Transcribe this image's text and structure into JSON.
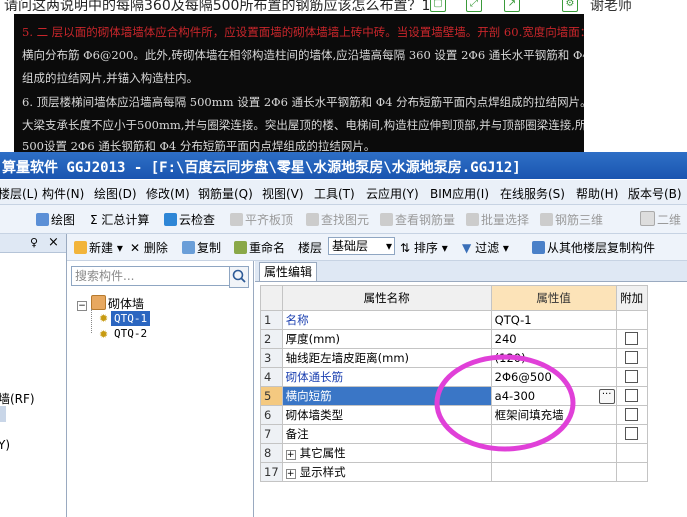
{
  "question": {
    "text": "请问这两说明中的每隔360及每隔500所布置的钢筋应该怎么布置？1",
    "icons": [
      "copy-icon",
      "expand-icon",
      "share-icon",
      "settings-icon"
    ],
    "teacher": "谢老师"
  },
  "doc_image": {
    "lines": [
      {
        "text": "5. 二 层以面的砌体墙墙体应合构件所，应设置面墙的砌体墙墙上砖中砖。当设置墙壁墙。开剖 60.宽度向墙面：墙2 Φ10.",
        "color": "#c8262b"
      },
      {
        "text": "   横向分布筋 Φ6@200。此外,砖砌体墙在相邻构造柱间的墙体,应沿墙高每隔 360 设置 2Φ6 通长水平钢筋和 Φ4 分布短筋平面内点焊",
        "color": "#d8d8d8"
      },
      {
        "text": "   组成的拉结网片,并锚入构造柱内。",
        "color": "#d8d8d8"
      },
      {
        "text": "6. 顶层楼梯间墙体应沿墙高每隔 500mm 设置 2Φ6 通长水平钢筋和 Φ4 分布短筋平面内点焊组成的拉结网片。楼梯间及门厅内墙阳角处的",
        "color": "#d8d8d8"
      },
      {
        "text": "   大梁支承长度不应小于500mm,并与圈梁连接。突出屋顶的楼、电梯间,构造柱应伸到顶部,并与顶部圈梁连接,所有墙体应沿墙高每隔",
        "color": "#d8d8d8"
      },
      {
        "text": "   500设置 2Φ6 通长钢筋和 Φ4 分布短筋平面内点焊组成的拉结网片。",
        "color": "#d8d8d8"
      }
    ]
  },
  "window": {
    "title": "算量软件 GGJ2013 - [F:\\百度云同步盘\\零星\\水源地泵房\\水源地泵房.GGJ12]"
  },
  "menu": [
    "楼层(L)",
    "构件(N)",
    "绘图(D)",
    "修改(M)",
    "钢筋量(Q)",
    "视图(V)",
    "工具(T)",
    "云应用(Y)",
    "BIM应用(I)",
    "在线服务(S)",
    "帮助(H)",
    "版本号(B)"
  ],
  "toolbar1": {
    "draw": "绘图",
    "summary": "Σ 汇总计算",
    "cloud_check": "云检查",
    "flat_board": "平齐板顶",
    "find_element": "查找图元",
    "view_rebar": "查看钢筋量",
    "batch_select": "批量选择",
    "rebar_3d": "钢筋三维",
    "view_2d": "二维"
  },
  "toolbar2": {
    "new": "新建",
    "delete": "删除",
    "copy": "复制",
    "rename": "重命名",
    "floor_label": "楼层",
    "floor_value": "基础层",
    "sort": "排序",
    "filter": "过滤",
    "copy_from_floor": "从其他楼层复制构件"
  },
  "left_panel": {
    "pin": "♀",
    "close": "×",
    "item_rf": "墙(RF)",
    "item_y": "Y)"
  },
  "tree": {
    "search_placeholder": "搜索构件...",
    "root": "砌体墙",
    "children": [
      "QTQ-1",
      "QTQ-2"
    ]
  },
  "props": {
    "tab": "属性编辑",
    "headers": {
      "name": "属性名称",
      "value": "属性值",
      "extra": "附加"
    },
    "rows": [
      {
        "num": "1",
        "name": "名称",
        "value": "QTQ-1",
        "checkbox": false,
        "blue": true
      },
      {
        "num": "2",
        "name": "厚度(mm)",
        "value": "240",
        "checkbox": true,
        "blue": false
      },
      {
        "num": "3",
        "name": "轴线距左墙皮距离(mm)",
        "value": "(120)",
        "checkbox": true,
        "blue": false
      },
      {
        "num": "4",
        "name": "砌体通长筋",
        "value": "2Φ6@500",
        "checkbox": true,
        "blue": true
      },
      {
        "num": "5",
        "name": "横向短筋",
        "value": "a4-300",
        "checkbox": true,
        "blue": false,
        "selected": true
      },
      {
        "num": "6",
        "name": "砌体墙类型",
        "value": "框架间填充墙",
        "checkbox": true,
        "blue": false
      },
      {
        "num": "7",
        "name": "备注",
        "value": "",
        "checkbox": true,
        "blue": false
      },
      {
        "num": "8",
        "name": "其它属性",
        "value": "",
        "checkbox": false,
        "blue": false,
        "group": true
      },
      {
        "num": "17",
        "name": "显示样式",
        "value": "",
        "checkbox": false,
        "blue": false,
        "group": true
      }
    ]
  },
  "colors": {
    "annotation_circle": "#e040d8",
    "title_bar": "#1a55b0",
    "selected_row": "#3a76c6",
    "value_header": "#fce3b8"
  }
}
